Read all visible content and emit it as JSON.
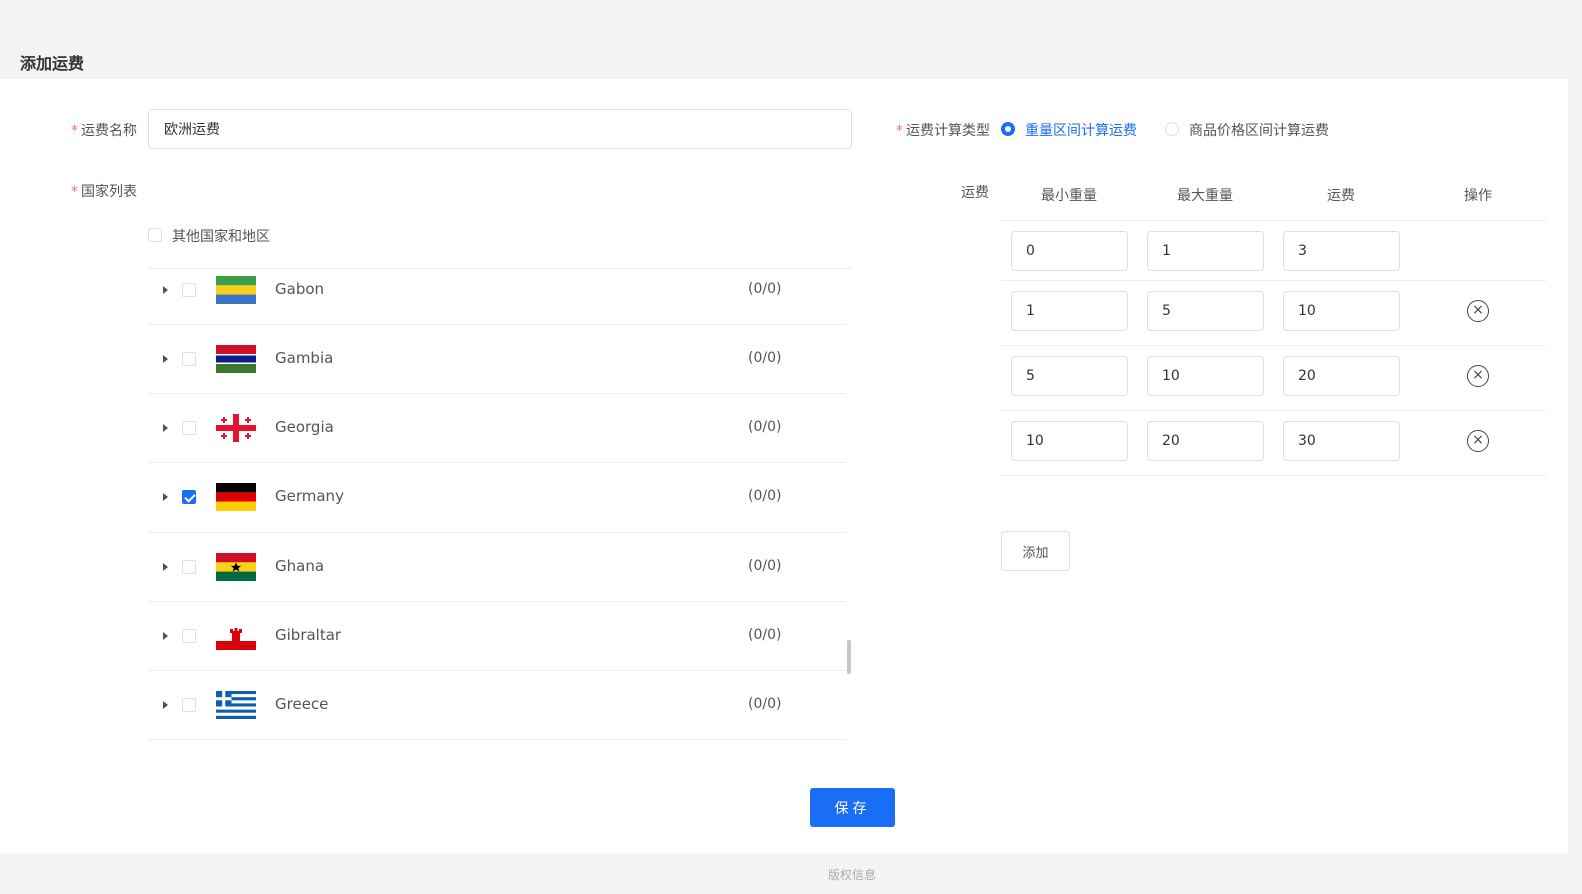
{
  "page": {
    "title": "添加运费",
    "footer": "版权信息"
  },
  "form": {
    "name_label": "运费名称",
    "name_value": "欧洲运费",
    "country_label": "国家列表",
    "other_regions_label": "其他国家和地区",
    "calc_type_label": "运费计算类型",
    "calc_options": [
      {
        "label": "重量区间计算运费",
        "selected": true
      },
      {
        "label": "商品价格区间计算运费",
        "selected": false
      }
    ],
    "fee_label": "运费"
  },
  "countries": [
    {
      "name": "Gabon",
      "count": "(0/0)",
      "checked": false,
      "flag": "gabon"
    },
    {
      "name": "Gambia",
      "count": "(0/0)",
      "checked": false,
      "flag": "gambia"
    },
    {
      "name": "Georgia",
      "count": "(0/0)",
      "checked": false,
      "flag": "georgia"
    },
    {
      "name": "Germany",
      "count": "(0/0)",
      "checked": true,
      "flag": "germany"
    },
    {
      "name": "Ghana",
      "count": "(0/0)",
      "checked": false,
      "flag": "ghana"
    },
    {
      "name": "Gibraltar",
      "count": "(0/0)",
      "checked": false,
      "flag": "gibraltar"
    },
    {
      "name": "Greece",
      "count": "(0/0)",
      "checked": false,
      "flag": "greece"
    }
  ],
  "fee_table": {
    "headers": [
      "最小重量",
      "最大重量",
      "运费",
      "操作"
    ],
    "rows": [
      {
        "min": "0",
        "max": "1",
        "fee": "3",
        "deletable": false
      },
      {
        "min": "1",
        "max": "5",
        "fee": "10",
        "deletable": true
      },
      {
        "min": "5",
        "max": "10",
        "fee": "20",
        "deletable": true
      },
      {
        "min": "10",
        "max": "20",
        "fee": "30",
        "deletable": true
      }
    ],
    "delete_icon": "×"
  },
  "buttons": {
    "add": "添加",
    "save": "保存"
  },
  "colors": {
    "primary": "#1a6ef5",
    "required": "#f56c6c"
  }
}
